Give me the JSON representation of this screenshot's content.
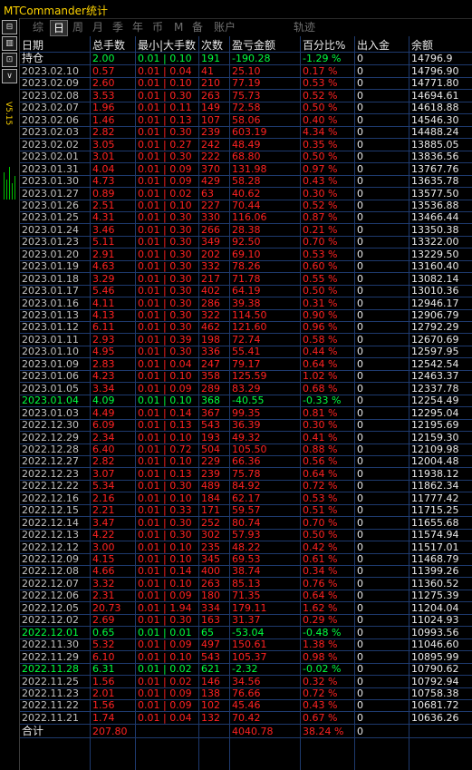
{
  "app": {
    "title": "MTCommander统计"
  },
  "side": {
    "version": "V5.15",
    "buttons": [
      {
        "name": "layout-icon",
        "glyph": "⊟"
      },
      {
        "name": "panel-icon",
        "glyph": "▥"
      },
      {
        "name": "expand-icon",
        "glyph": "⊡"
      },
      {
        "name": "menu-icon",
        "glyph": "∨"
      }
    ]
  },
  "tabs": [
    "综",
    "日",
    "周",
    "月",
    "季",
    "年",
    "币",
    "M",
    "备",
    "账户",
    "轨迹"
  ],
  "active_tab": "日",
  "colors": {
    "profit": "#ff2222",
    "loss": "#00ff40",
    "header": "#e8e8e8",
    "title": "#ffd400"
  },
  "table": {
    "headers": [
      "日期",
      "总手数",
      "最小|大手数",
      "次数",
      "盈亏金额",
      "百分比%",
      "出入金",
      "余额"
    ],
    "holding": {
      "label": "持仓",
      "lots": "2.00",
      "minmax": "0.01 | 0.10",
      "count": "191",
      "pnl": "-190.28",
      "pct": "-1.29 %",
      "flow": "0",
      "balance": "14796.9"
    },
    "rows": [
      {
        "date": "2023.02.10",
        "lots": "0.57",
        "minmax": "0.01 | 0.04",
        "count": "41",
        "pnl": "25.10",
        "pct": "0.17 %",
        "flow": "0",
        "balance": "14796.90",
        "dir": "up"
      },
      {
        "date": "2023.02.09",
        "lots": "2.60",
        "minmax": "0.01 | 0.10",
        "count": "210",
        "pnl": "77.19",
        "pct": "0.53 %",
        "flow": "0",
        "balance": "14771.80",
        "dir": "up"
      },
      {
        "date": "2023.02.08",
        "lots": "3.53",
        "minmax": "0.01 | 0.30",
        "count": "263",
        "pnl": "75.73",
        "pct": "0.52 %",
        "flow": "0",
        "balance": "14694.61",
        "dir": "up"
      },
      {
        "date": "2023.02.07",
        "lots": "1.96",
        "minmax": "0.01 | 0.11",
        "count": "149",
        "pnl": "72.58",
        "pct": "0.50 %",
        "flow": "0",
        "balance": "14618.88",
        "dir": "up"
      },
      {
        "date": "2023.02.06",
        "lots": "1.46",
        "minmax": "0.01 | 0.13",
        "count": "107",
        "pnl": "58.06",
        "pct": "0.40 %",
        "flow": "0",
        "balance": "14546.30",
        "dir": "up"
      },
      {
        "date": "2023.02.03",
        "lots": "2.82",
        "minmax": "0.01 | 0.30",
        "count": "239",
        "pnl": "603.19",
        "pct": "4.34 %",
        "flow": "0",
        "balance": "14488.24",
        "dir": "up"
      },
      {
        "date": "2023.02.02",
        "lots": "3.05",
        "minmax": "0.01 | 0.27",
        "count": "242",
        "pnl": "48.49",
        "pct": "0.35 %",
        "flow": "0",
        "balance": "13885.05",
        "dir": "up"
      },
      {
        "date": "2023.02.01",
        "lots": "3.01",
        "minmax": "0.01 | 0.30",
        "count": "222",
        "pnl": "68.80",
        "pct": "0.50 %",
        "flow": "0",
        "balance": "13836.56",
        "dir": "up"
      },
      {
        "date": "2023.01.31",
        "lots": "4.04",
        "minmax": "0.01 | 0.09",
        "count": "370",
        "pnl": "131.98",
        "pct": "0.97 %",
        "flow": "0",
        "balance": "13767.76",
        "dir": "up"
      },
      {
        "date": "2023.01.30",
        "lots": "4.73",
        "minmax": "0.01 | 0.09",
        "count": "429",
        "pnl": "58.28",
        "pct": "0.43 %",
        "flow": "0",
        "balance": "13635.78",
        "dir": "up"
      },
      {
        "date": "2023.01.27",
        "lots": "0.89",
        "minmax": "0.01 | 0.02",
        "count": "63",
        "pnl": "40.62",
        "pct": "0.30 %",
        "flow": "0",
        "balance": "13577.50",
        "dir": "up"
      },
      {
        "date": "2023.01.26",
        "lots": "2.51",
        "minmax": "0.01 | 0.10",
        "count": "227",
        "pnl": "70.44",
        "pct": "0.52 %",
        "flow": "0",
        "balance": "13536.88",
        "dir": "up"
      },
      {
        "date": "2023.01.25",
        "lots": "4.31",
        "minmax": "0.01 | 0.30",
        "count": "330",
        "pnl": "116.06",
        "pct": "0.87 %",
        "flow": "0",
        "balance": "13466.44",
        "dir": "up"
      },
      {
        "date": "2023.01.24",
        "lots": "3.46",
        "minmax": "0.01 | 0.30",
        "count": "266",
        "pnl": "28.38",
        "pct": "0.21 %",
        "flow": "0",
        "balance": "13350.38",
        "dir": "up"
      },
      {
        "date": "2023.01.23",
        "lots": "5.11",
        "minmax": "0.01 | 0.30",
        "count": "349",
        "pnl": "92.50",
        "pct": "0.70 %",
        "flow": "0",
        "balance": "13322.00",
        "dir": "up"
      },
      {
        "date": "2023.01.20",
        "lots": "2.91",
        "minmax": "0.01 | 0.30",
        "count": "202",
        "pnl": "69.10",
        "pct": "0.53 %",
        "flow": "0",
        "balance": "13229.50",
        "dir": "up"
      },
      {
        "date": "2023.01.19",
        "lots": "4.63",
        "minmax": "0.01 | 0.30",
        "count": "332",
        "pnl": "78.26",
        "pct": "0.60 %",
        "flow": "0",
        "balance": "13160.40",
        "dir": "up"
      },
      {
        "date": "2023.01.18",
        "lots": "3.29",
        "minmax": "0.01 | 0.30",
        "count": "217",
        "pnl": "71.78",
        "pct": "0.55 %",
        "flow": "0",
        "balance": "13082.14",
        "dir": "up"
      },
      {
        "date": "2023.01.17",
        "lots": "5.46",
        "minmax": "0.01 | 0.30",
        "count": "402",
        "pnl": "64.19",
        "pct": "0.50 %",
        "flow": "0",
        "balance": "13010.36",
        "dir": "up"
      },
      {
        "date": "2023.01.16",
        "lots": "4.11",
        "minmax": "0.01 | 0.30",
        "count": "286",
        "pnl": "39.38",
        "pct": "0.31 %",
        "flow": "0",
        "balance": "12946.17",
        "dir": "up"
      },
      {
        "date": "2023.01.13",
        "lots": "4.13",
        "minmax": "0.01 | 0.30",
        "count": "322",
        "pnl": "114.50",
        "pct": "0.90 %",
        "flow": "0",
        "balance": "12906.79",
        "dir": "up"
      },
      {
        "date": "2023.01.12",
        "lots": "6.11",
        "minmax": "0.01 | 0.30",
        "count": "462",
        "pnl": "121.60",
        "pct": "0.96 %",
        "flow": "0",
        "balance": "12792.29",
        "dir": "up"
      },
      {
        "date": "2023.01.11",
        "lots": "2.93",
        "minmax": "0.01 | 0.39",
        "count": "198",
        "pnl": "72.74",
        "pct": "0.58 %",
        "flow": "0",
        "balance": "12670.69",
        "dir": "up"
      },
      {
        "date": "2023.01.10",
        "lots": "4.95",
        "minmax": "0.01 | 0.30",
        "count": "336",
        "pnl": "55.41",
        "pct": "0.44 %",
        "flow": "0",
        "balance": "12597.95",
        "dir": "up"
      },
      {
        "date": "2023.01.09",
        "lots": "2.83",
        "minmax": "0.01 | 0.04",
        "count": "247",
        "pnl": "79.17",
        "pct": "0.64 %",
        "flow": "0",
        "balance": "12542.54",
        "dir": "up"
      },
      {
        "date": "2023.01.06",
        "lots": "4.23",
        "minmax": "0.01 | 0.10",
        "count": "358",
        "pnl": "125.59",
        "pct": "1.02 %",
        "flow": "0",
        "balance": "12463.37",
        "dir": "up"
      },
      {
        "date": "2023.01.05",
        "lots": "3.34",
        "minmax": "0.01 | 0.09",
        "count": "289",
        "pnl": "83.29",
        "pct": "0.68 %",
        "flow": "0",
        "balance": "12337.78",
        "dir": "up"
      },
      {
        "date": "2023.01.04",
        "lots": "4.09",
        "minmax": "0.01 | 0.10",
        "count": "368",
        "pnl": "-40.55",
        "pct": "-0.33 %",
        "flow": "0",
        "balance": "12254.49",
        "dir": "down"
      },
      {
        "date": "2023.01.03",
        "lots": "4.49",
        "minmax": "0.01 | 0.14",
        "count": "367",
        "pnl": "99.35",
        "pct": "0.81 %",
        "flow": "0",
        "balance": "12295.04",
        "dir": "up"
      },
      {
        "date": "2022.12.30",
        "lots": "6.09",
        "minmax": "0.01 | 0.13",
        "count": "543",
        "pnl": "36.39",
        "pct": "0.30 %",
        "flow": "0",
        "balance": "12195.69",
        "dir": "up"
      },
      {
        "date": "2022.12.29",
        "lots": "2.34",
        "minmax": "0.01 | 0.10",
        "count": "193",
        "pnl": "49.32",
        "pct": "0.41 %",
        "flow": "0",
        "balance": "12159.30",
        "dir": "up"
      },
      {
        "date": "2022.12.28",
        "lots": "6.40",
        "minmax": "0.01 | 0.72",
        "count": "504",
        "pnl": "105.50",
        "pred": "",
        "pct": "0.88 %",
        "flow": "0",
        "balance": "12109.98",
        "dir": "up"
      },
      {
        "date": "2022.12.27",
        "lots": "2.82",
        "minmax": "0.01 | 0.10",
        "count": "229",
        "pnl": "66.36",
        "pct": "0.56 %",
        "flow": "0",
        "balance": "12004.48",
        "dir": "up"
      },
      {
        "date": "2022.12.23",
        "lots": "3.07",
        "minmax": "0.01 | 0.13",
        "count": "239",
        "pnl": "75.78",
        "pct": "0.64 %",
        "flow": "0",
        "balance": "11938.12",
        "dir": "up"
      },
      {
        "date": "2022.12.22",
        "lots": "5.34",
        "minmax": "0.01 | 0.30",
        "count": "489",
        "pnl": "84.92",
        "pct": "0.72 %",
        "flow": "0",
        "balance": "11862.34",
        "dir": "up"
      },
      {
        "date": "2022.12.16",
        "lots": "2.16",
        "minmax": "0.01 | 0.10",
        "count": "184",
        "pnl": "62.17",
        "pct": "0.53 %",
        "flow": "0",
        "balance": "11777.42",
        "dir": "up"
      },
      {
        "date": "2022.12.15",
        "lots": "2.21",
        "minmax": "0.01 | 0.33",
        "count": "171",
        "pnl": "59.57",
        "pct": "0.51 %",
        "flow": "0",
        "balance": "11715.25",
        "dir": "up"
      },
      {
        "date": "2022.12.14",
        "lots": "3.47",
        "minmax": "0.01 | 0.30",
        "count": "252",
        "pnl": "80.74",
        "pct": "0.70 %",
        "flow": "0",
        "balance": "11655.68",
        "dir": "up"
      },
      {
        "date": "2022.12.13",
        "lots": "4.22",
        "minmax": "0.01 | 0.30",
        "count": "302",
        "pnl": "57.93",
        "pct": "0.50 %",
        "flow": "0",
        "balance": "11574.94",
        "dir": "up"
      },
      {
        "date": "2022.12.12",
        "lots": "3.00",
        "minmax": "0.01 | 0.10",
        "count": "235",
        "pnl": "48.22",
        "pct": "0.42 %",
        "flow": "0",
        "balance": "11517.01",
        "dir": "up"
      },
      {
        "date": "2022.12.09",
        "lots": "4.15",
        "minmax": "0.01 | 0.10",
        "count": "345",
        "pnl": "69.53",
        "pct": "0.61 %",
        "flow": "0",
        "balance": "11468.79",
        "dir": "up"
      },
      {
        "date": "2022.12.08",
        "lots": "4.66",
        "minmax": "0.01 | 0.14",
        "count": "400",
        "pnl": "38.74",
        "pct": "0.34 %",
        "flow": "0",
        "balance": "11399.26",
        "dir": "up"
      },
      {
        "date": "2022.12.07",
        "lots": "3.32",
        "minmax": "0.01 | 0.10",
        "count": "263",
        "pnl": "85.13",
        "pct": "0.76 %",
        "flow": "0",
        "balance": "11360.52",
        "dir": "up"
      },
      {
        "date": "2022.12.06",
        "lots": "2.31",
        "minmax": "0.01 | 0.09",
        "count": "180",
        "pnl": "71.35",
        "pct": "0.64 %",
        "flow": "0",
        "balance": "11275.39",
        "dir": "up"
      },
      {
        "date": "2022.12.05",
        "lots": "20.73",
        "minmax": "0.01 | 1.94",
        "count": "334",
        "pnl": "179.11",
        "pct": "1.62 %",
        "flow": "0",
        "balance": "11204.04",
        "dir": "up"
      },
      {
        "date": "2022.12.02",
        "lots": "2.69",
        "minmax": "0.01 | 0.30",
        "count": "163",
        "pnl": "31.37",
        "pct": "0.29 %",
        "flow": "0",
        "balance": "11024.93",
        "dir": "up"
      },
      {
        "date": "2022.12.01",
        "lots": "0.65",
        "minmax": "0.01 | 0.01",
        "count": "65",
        "pnl": "-53.04",
        "pct": "-0.48 %",
        "flow": "0",
        "balance": "10993.56",
        "dir": "down"
      },
      {
        "date": "2022.11.30",
        "lots": "5.32",
        "minmax": "0.01 | 0.09",
        "count": "497",
        "pnl": "150.61",
        "pct": "1.38 %",
        "flow": "0",
        "balance": "11046.60",
        "dir": "up"
      },
      {
        "date": "2022.11.29",
        "lots": "6.10",
        "minmax": "0.01 | 0.10",
        "count": "543",
        "pnl": "105.37",
        "pct": "0.98 %",
        "flow": "0",
        "balance": "10895.99",
        "dir": "up"
      },
      {
        "date": "2022.11.28",
        "lots": "6.31",
        "minmax": "0.01 | 0.02",
        "count": "621",
        "pnl": "-2.32",
        "pct": "-0.02 %",
        "flow": "0",
        "balance": "10790.62",
        "dir": "down"
      },
      {
        "date": "2022.11.25",
        "lots": "1.56",
        "minmax": "0.01 | 0.02",
        "count": "146",
        "pnl": "34.56",
        "pct": "0.32 %",
        "flow": "0",
        "balance": "10792.94",
        "dir": "up"
      },
      {
        "date": "2022.11.23",
        "lots": "2.01",
        "minmax": "0.01 | 0.09",
        "count": "138",
        "pnl": "76.66",
        "pct": "0.72 %",
        "flow": "0",
        "balance": "10758.38",
        "dir": "up"
      },
      {
        "date": "2022.11.22",
        "lots": "1.56",
        "minmax": "0.01 | 0.09",
        "count": "102",
        "pnl": "45.46",
        "pct": "0.43 %",
        "flow": "0",
        "balance": "10681.72",
        "dir": "up"
      },
      {
        "date": "2022.11.21",
        "lots": "1.74",
        "minmax": "0.01 | 0.04",
        "count": "132",
        "pnl": "70.42",
        "pct": "0.67 %",
        "flow": "0",
        "balance": "10636.26",
        "dir": "up"
      }
    ],
    "total": {
      "label": "合计",
      "lots": "207.80",
      "pnl": "4040.78",
      "pct": "38.24 %",
      "flow": "0"
    }
  }
}
